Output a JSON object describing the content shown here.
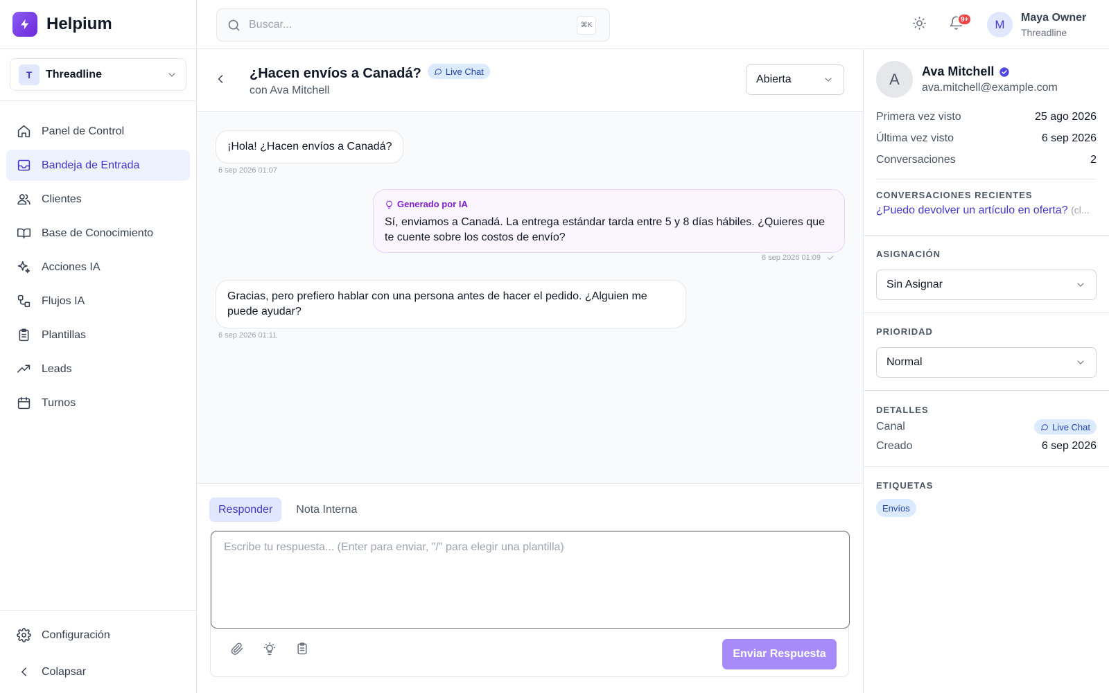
{
  "brand": {
    "name": "Helpium"
  },
  "workspace": {
    "initial": "T",
    "name": "Threadline"
  },
  "nav": [
    {
      "label": "Panel de Control",
      "icon": "home-icon",
      "active": false
    },
    {
      "label": "Bandeja de Entrada",
      "icon": "inbox-icon",
      "active": true
    },
    {
      "label": "Clientes",
      "icon": "users-icon",
      "active": false
    },
    {
      "label": "Base de Conocimiento",
      "icon": "book-icon",
      "active": false
    },
    {
      "label": "Acciones IA",
      "icon": "sparkles-icon",
      "active": false
    },
    {
      "label": "Flujos IA",
      "icon": "workflow-icon",
      "active": false
    },
    {
      "label": "Plantillas",
      "icon": "clipboard-icon",
      "active": false
    },
    {
      "label": "Leads",
      "icon": "trending-up-icon",
      "active": false
    },
    {
      "label": "Turnos",
      "icon": "calendar-icon",
      "active": false
    }
  ],
  "sidebar_bottom": {
    "settings_label": "Configuración",
    "collapse_label": "Colapsar"
  },
  "search": {
    "placeholder": "Buscar...",
    "shortcut": "⌘K"
  },
  "notifications": {
    "badge": "9+"
  },
  "user": {
    "initial": "M",
    "name": "Maya Owner",
    "org": "Threadline"
  },
  "conversation": {
    "title": "¿Hacen envíos a Canadá?",
    "channel": "Live Chat",
    "subtitle": "con Ava Mitchell",
    "status": "Abierta",
    "messages": [
      {
        "text": "¡Hola! ¿Hacen envíos a Canadá?",
        "time": "6 sep 2026 01:07"
      },
      {
        "ai_label": "Generado por IA",
        "text": "Sí, enviamos a Canadá. La entrega estándar tarda entre 5 y 8 días hábiles. ¿Quieres que te cuente sobre los costos de envío?",
        "time": "6 sep 2026 01:09"
      },
      {
        "text": "Gracias, pero prefiero hablar con una persona antes de hacer el pedido. ¿Alguien me puede ayudar?",
        "time": "6 sep 2026 01:11"
      }
    ]
  },
  "composer": {
    "tab_reply": "Responder",
    "tab_note": "Nota Interna",
    "placeholder": "Escribe tu respuesta... (Enter para enviar, \"/\" para elegir una plantilla)",
    "send_label": "Enviar Respuesta"
  },
  "customer": {
    "initial": "A",
    "name": "Ava Mitchell",
    "email": "ava.mitchell@example.com",
    "first_seen_label": "Primera vez visto",
    "first_seen": "25 ago 2026",
    "last_seen_label": "Última vez visto",
    "last_seen": "6 sep 2026",
    "conversations_label": "Conversaciones",
    "conversations": "2",
    "recent_title": "CONVERSACIONES RECIENTES",
    "recent_link": "¿Puedo devolver un artículo en oferta?",
    "recent_status": "(cl..."
  },
  "assignment": {
    "title": "ASIGNACIÓN",
    "value": "Sin Asignar"
  },
  "priority": {
    "title": "PRIORIDAD",
    "value": "Normal"
  },
  "details": {
    "title": "DETALLES",
    "channel_label": "Canal",
    "channel": "Live Chat",
    "created_label": "Creado",
    "created": "6 sep 2026"
  },
  "tags": {
    "title": "ETIQUETAS",
    "items": [
      "Envíos"
    ]
  },
  "colors": {
    "accent": "#4338ca",
    "brand": "#7c3aed",
    "ai": "#7e22ce",
    "badge": "#ef4444"
  }
}
